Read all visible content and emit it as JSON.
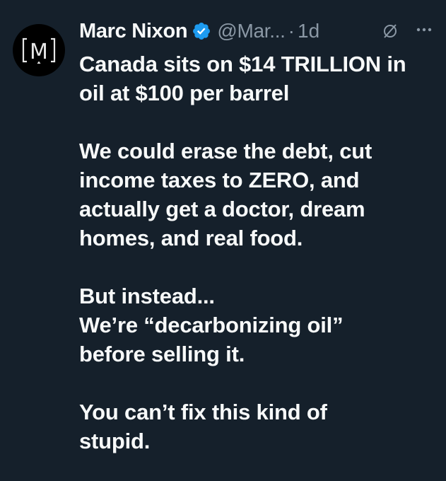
{
  "tweet": {
    "author_name": "Marc Nixon",
    "handle": "@Mar...",
    "separator": "·",
    "time": "1d",
    "avatar_letter": "M",
    "verified_color": "#1d9bf0",
    "icons": {
      "verified": "verified-badge-icon",
      "grok": "grok-icon",
      "more": "more-icon"
    },
    "paragraphs": [
      [
        "Canada sits on $14 TRILLION in",
        "oil at $100 per barrel"
      ],
      [
        "We could erase the debt, cut",
        "income taxes to ZERO, and",
        "actually get a doctor, dream",
        "homes, and real food."
      ],
      [
        "But instead...",
        "We’re “decarbonizing oil”",
        "before selling it."
      ],
      [
        "You can’t fix this kind of",
        "stupid."
      ]
    ]
  },
  "theme": {
    "background": "#15202b",
    "text": "#f7f9f9",
    "muted": "#8b98a5"
  }
}
